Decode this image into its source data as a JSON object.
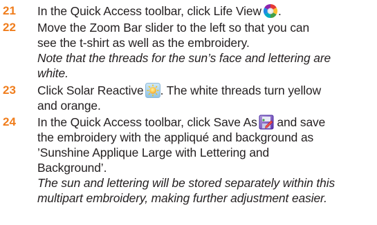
{
  "steps": [
    {
      "number": "21",
      "lines": [
        {
          "pre": "In the Quick Access toolbar, click Life View",
          "post": "."
        }
      ],
      "icon": "life-view-icon"
    },
    {
      "number": "22",
      "lines": [
        "Move the Zoom Bar slider to the left so that you can",
        "see the t-shirt as well as the embroidery."
      ],
      "note_lines": [
        "Note that the threads for the sun’s face and lettering are",
        "white."
      ]
    },
    {
      "number": "23",
      "lines": [
        {
          "pre": "Click Solar Reactive",
          "post": ". The white threads turn yellow"
        },
        "and orange."
      ],
      "icon": "solar-reactive-icon"
    },
    {
      "number": "24",
      "lines": [
        {
          "pre": "In the Quick Access toolbar, click Save As",
          "post": " and save"
        },
        "the embroidery with the appliqué and background as",
        "’Sunshine Applique Large with Lettering and",
        "Background’."
      ],
      "note_lines": [
        "The sun and lettering will be stored separately within this",
        "multipart embroidery, making further adjustment easier."
      ],
      "icon": "save-as-icon"
    }
  ],
  "colors": {
    "step_number": "#f07d1c",
    "text": "#231f20"
  }
}
